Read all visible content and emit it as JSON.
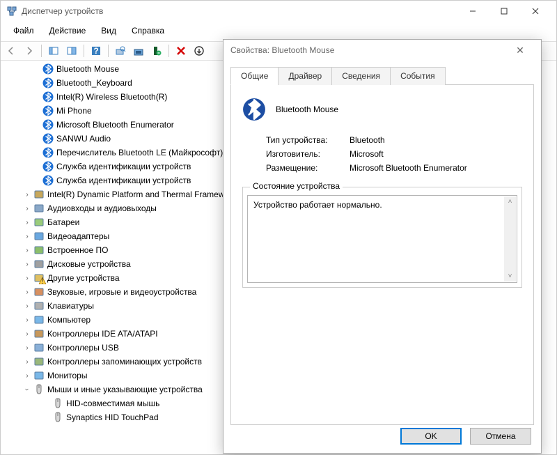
{
  "window": {
    "title": "Диспетчер устройств"
  },
  "menu": {
    "file": "Файл",
    "action": "Действие",
    "view": "Вид",
    "help": "Справка"
  },
  "tree": {
    "btItems": [
      "Bluetooth Mouse",
      "Bluetooth_Keyboard",
      "Intel(R) Wireless Bluetooth(R)",
      "Mi Phone",
      "Microsoft Bluetooth Enumerator",
      "SANWU Audio",
      "Перечислитель Bluetooth LE (Майкрософт)",
      "Служба идентификации устройств",
      "Служба идентификации устройств"
    ],
    "categories": [
      "Intel(R) Dynamic Platform and Thermal Framework",
      "Аудиовходы и аудиовыходы",
      "Батареи",
      "Видеоадаптеры",
      "Встроенное ПО",
      "Дисковые устройства",
      "Другие устройства",
      "Звуковые, игровые и видеоустройства",
      "Клавиатуры",
      "Компьютер",
      "Контроллеры IDE ATA/ATAPI",
      "Контроллеры USB",
      "Контроллеры запоминающих устройств",
      "Мониторы"
    ],
    "miceCat": "Мыши и иные указывающие устройства",
    "mice": [
      "HID-совместимая мышь",
      "Synaptics HID TouchPad"
    ]
  },
  "props": {
    "title": "Свойства: Bluetooth Mouse",
    "tabs": {
      "general": "Общие",
      "driver": "Драйвер",
      "details": "Сведения",
      "events": "События"
    },
    "deviceName": "Bluetooth Mouse",
    "labels": {
      "type": "Тип устройства:",
      "manufacturer": "Изготовитель:",
      "location": "Размещение:",
      "statusGroup": "Состояние устройства"
    },
    "values": {
      "type": "Bluetooth",
      "manufacturer": "Microsoft",
      "location": "Microsoft Bluetooth Enumerator"
    },
    "statusText": "Устройство работает нормально.",
    "buttons": {
      "ok": "OK",
      "cancel": "Отмена"
    }
  }
}
